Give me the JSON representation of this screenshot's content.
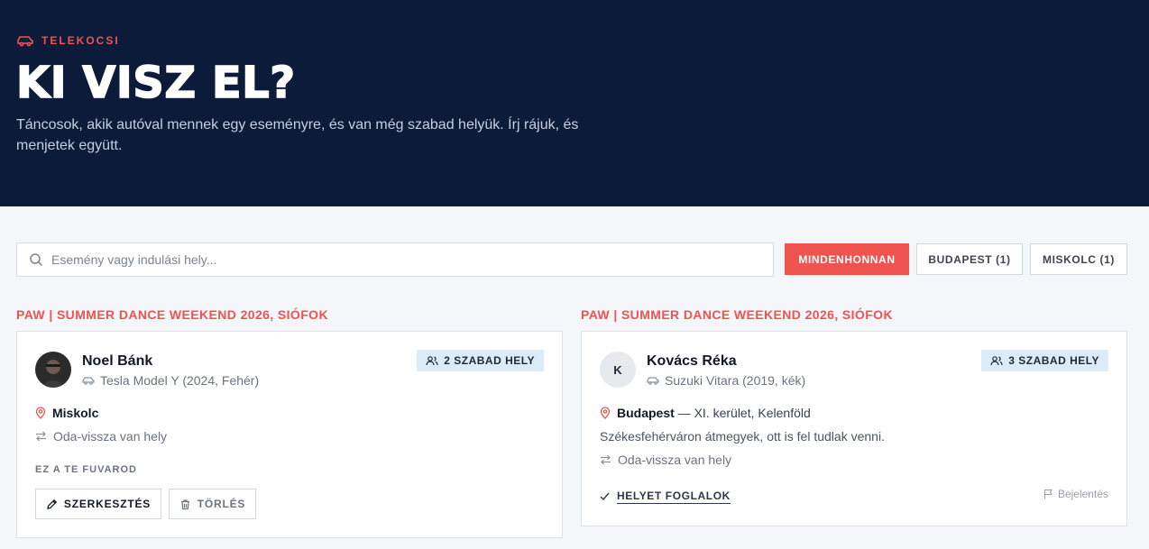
{
  "header": {
    "brand": "TELEKOCSI",
    "title": "KI VISZ EL?",
    "subtitle": "Táncosok, akik autóval mennek egy eseményre, és van még szabad helyük. Írj rájuk, és menjetek együtt."
  },
  "search": {
    "placeholder": "Esemény vagy indulási hely...",
    "value": ""
  },
  "filters": [
    {
      "label": "MINDENHONNAN",
      "active": true
    },
    {
      "label": "BUDAPEST (1)",
      "active": false
    },
    {
      "label": "MISKOLC (1)",
      "active": false
    }
  ],
  "rides": [
    {
      "event": "PAW | SUMMER DANCE WEEKEND 2026, SIÓFOK",
      "driver": "Noel Bánk",
      "car": "Tesla Model Y (2024, Fehér)",
      "seats": "2 SZABAD HELY",
      "location": "Miskolc",
      "round_trip": "Oda-vissza van hely",
      "own_label": "EZ A TE FUVAROD",
      "edit_label": "SZERKESZTÉS",
      "delete_label": "TÖRLÉS"
    },
    {
      "event": "PAW | SUMMER DANCE WEEKEND 2026, SIÓFOK",
      "driver": "Kovács Réka",
      "avatar_letter": "K",
      "car": "Suzuki Vitara (2019, kék)",
      "seats": "3 SZABAD HELY",
      "location": "Budapest",
      "location_detail": " — XI. kerület, Kelenföld",
      "note": "Székesfehérváron átmegyek, ott is fel tudlak venni.",
      "round_trip": "Oda-vissza van hely",
      "book_label": "HELYET FOGLALOK",
      "report_label": "Bejelentés"
    }
  ],
  "colors": {
    "hero_bg": "#0d1b3a",
    "accent": "#ef5350",
    "badge_bg": "#dcebf8",
    "page_bg": "#f4f6fa"
  }
}
